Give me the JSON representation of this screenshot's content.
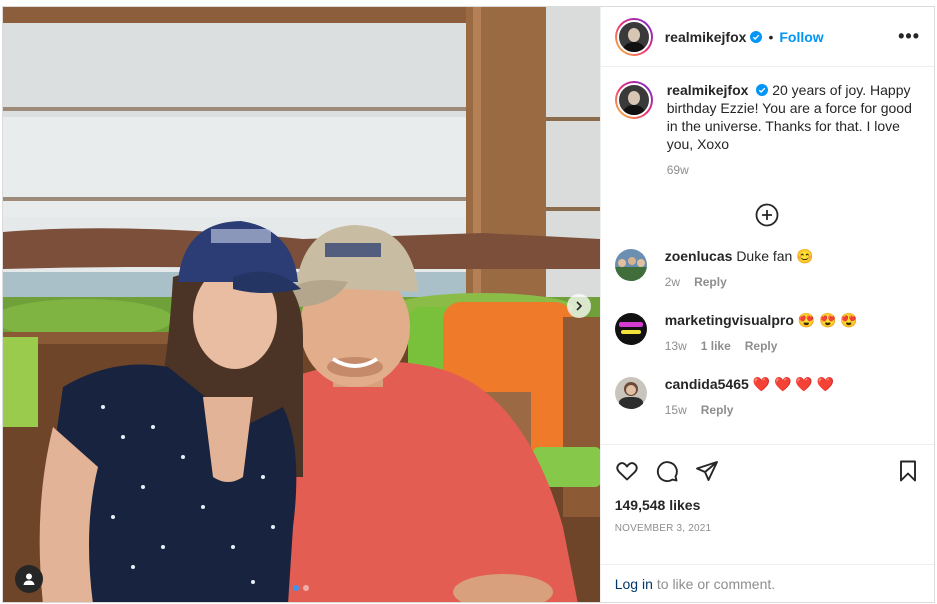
{
  "post": {
    "username": "realmikejfox",
    "follow_label": "Follow",
    "separator": "•",
    "more_label": "•••",
    "caption": "20 years of joy. Happy birthday Ezzie! You are a force for good in the universe. Thanks for that. I love you, Xoxo",
    "caption_age": "69w",
    "likes": "149,548 likes",
    "date": "NOVEMBER 3, 2021",
    "photo_colors": {
      "cap_left": "#2b3d74",
      "cap_right": "#c8bca2",
      "shirt_right": "#e35d52",
      "dress_left": "#17233f",
      "pillow_green": "#79c13b",
      "pillow_orange": "#ef7a2a"
    }
  },
  "comments": [
    {
      "user": "zoenlucas",
      "text": "Duke fan 😊",
      "age": "2w",
      "likes": "",
      "reply": "Reply"
    },
    {
      "user": "marketingvisualpro",
      "text": "😍 😍 😍",
      "age": "13w",
      "likes": "1 like",
      "reply": "Reply"
    },
    {
      "user": "candida5465",
      "text": "❤️ ❤️ ❤️ ❤️",
      "age": "15w",
      "likes": "",
      "reply": "Reply"
    }
  ],
  "icons": {
    "like": "heart-icon",
    "comment": "comment-icon",
    "share": "paper-plane-icon",
    "save": "bookmark-icon",
    "load_more": "plus-circle-icon",
    "next": "chevron-right-icon",
    "tag": "user-tag-icon",
    "verified": "verified-badge-icon"
  },
  "login": {
    "link": "Log in",
    "rest": "to like or comment."
  }
}
